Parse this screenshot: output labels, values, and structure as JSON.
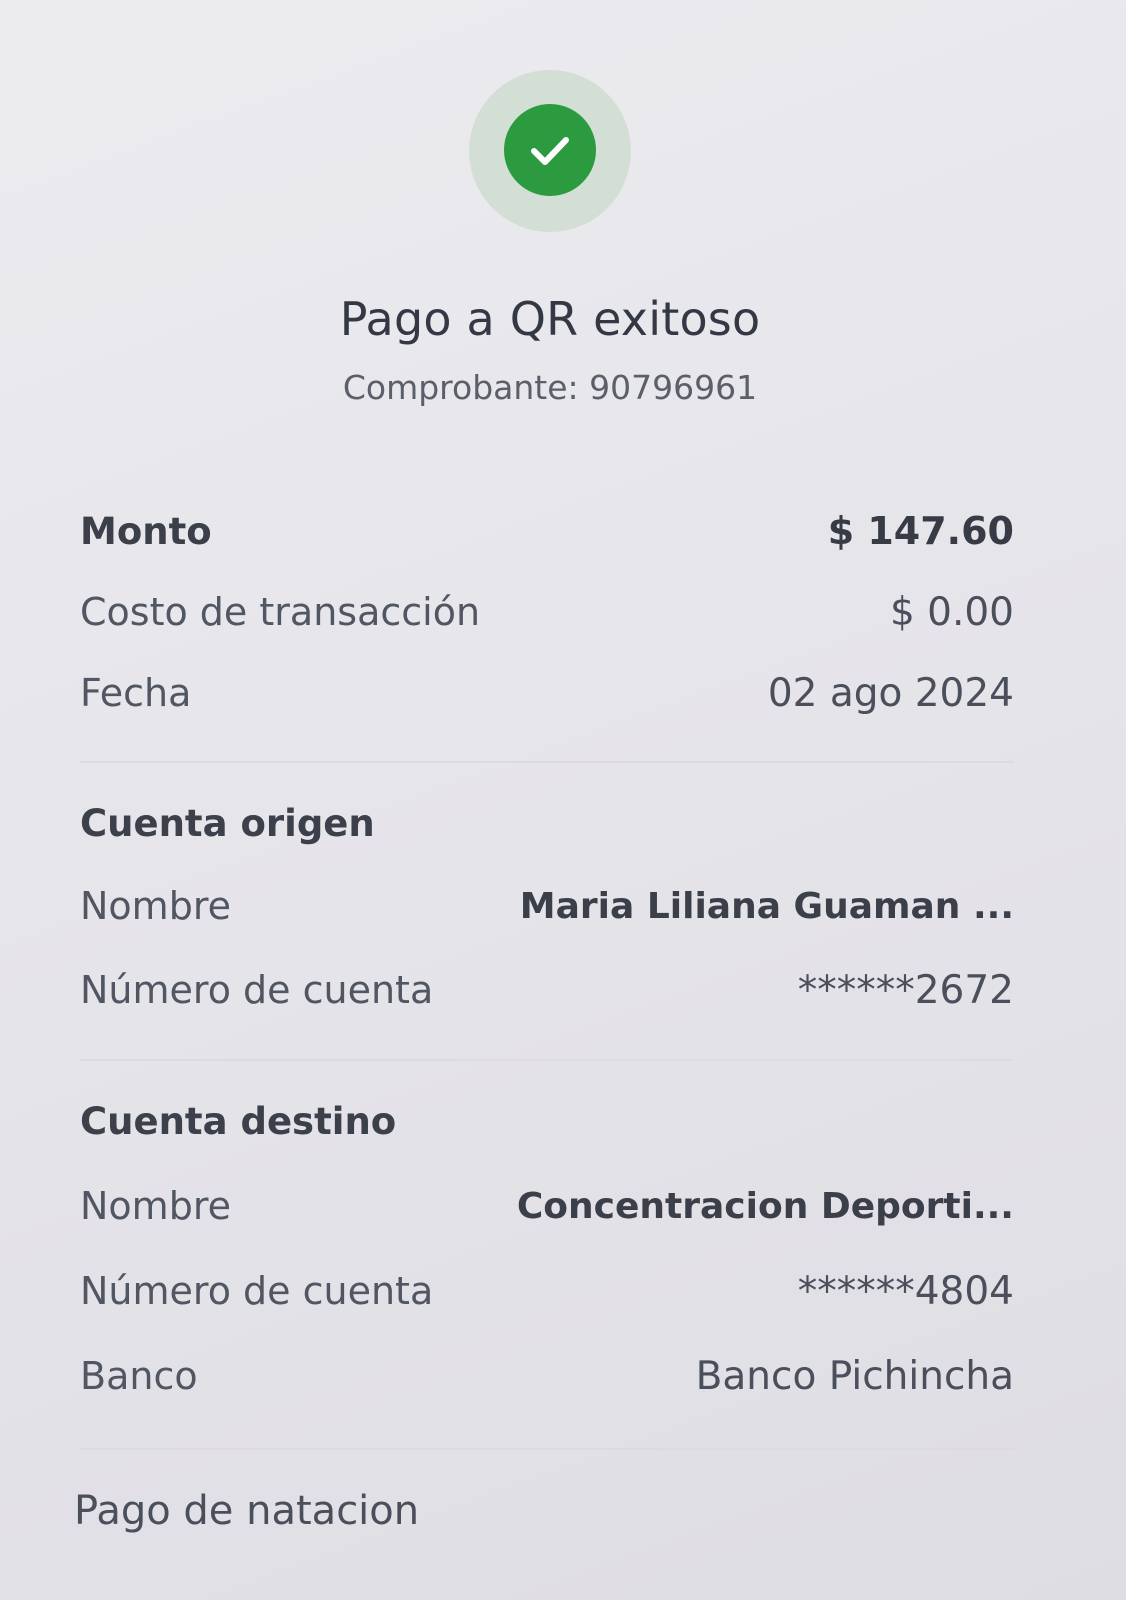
{
  "status": {
    "icon": "check-icon",
    "color": "#2c9a3e",
    "title": "Pago a QR exitoso",
    "receipt": "Comprobante: 90796961"
  },
  "summary": {
    "amount_label": "Monto",
    "amount_value": "$ 147.60",
    "fee_label": "Costo de transacción",
    "fee_value": "$ 0.00",
    "date_label": "Fecha",
    "date_value": "02 ago 2024"
  },
  "origin": {
    "title": "Cuenta origen",
    "name_label": "Nombre",
    "name_value": "Maria Liliana Guaman ...",
    "account_label": "Número de cuenta",
    "account_value": "******2672"
  },
  "destination": {
    "title": "Cuenta destino",
    "name_label": "Nombre",
    "name_value": "Concentracion Deporti...",
    "account_label": "Número de cuenta",
    "account_value": "******4804",
    "bank_label": "Banco",
    "bank_value": "Banco Pichincha"
  },
  "note": "Pago de natacion"
}
